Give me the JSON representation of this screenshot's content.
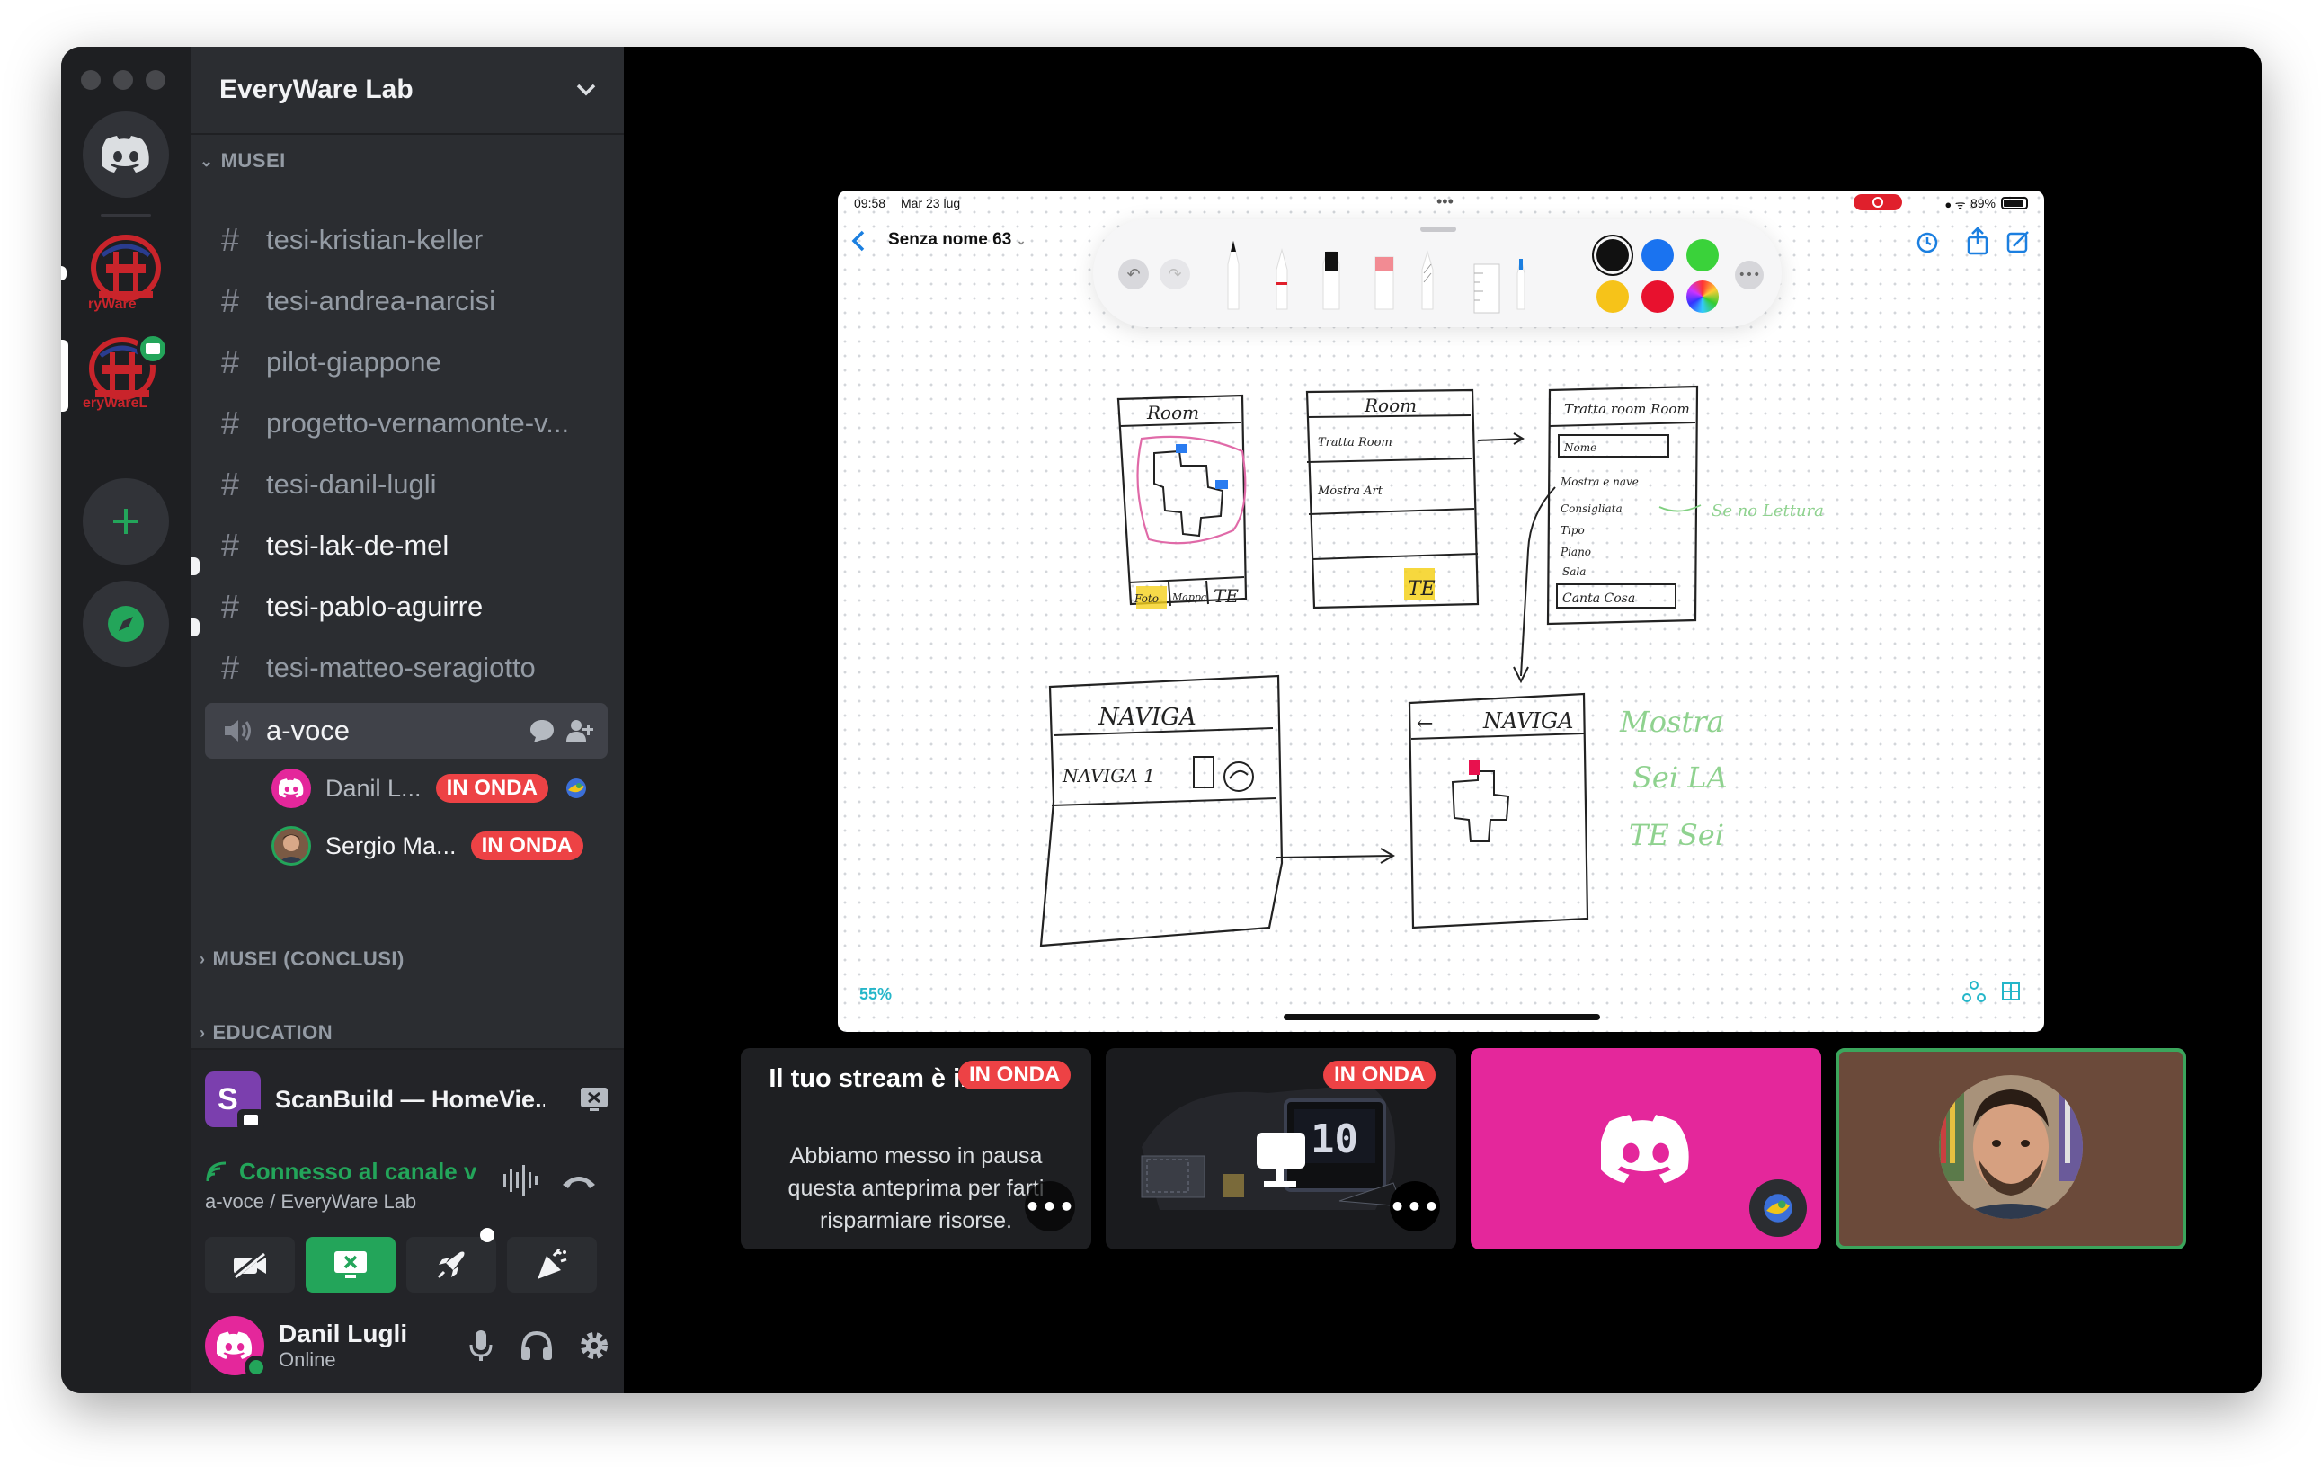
{
  "server": {
    "name": "EveryWare Lab",
    "rail_logo_text_1": "ryWare",
    "rail_logo_text_2": "eryWareL"
  },
  "categories": {
    "musei": "MUSEI",
    "musei_conclusi": "MUSEI (CONCLUSI)",
    "education": "EDUCATION"
  },
  "channels": [
    {
      "name": "tesi-kristian-keller",
      "unread": false
    },
    {
      "name": "tesi-andrea-narcisi",
      "unread": false
    },
    {
      "name": "pilot-giappone",
      "unread": false
    },
    {
      "name": "progetto-vernamonte-v...",
      "unread": false
    },
    {
      "name": "tesi-danil-lugli",
      "unread": false
    },
    {
      "name": "tesi-lak-de-mel",
      "unread": true
    },
    {
      "name": "tesi-pablo-aguirre",
      "unread": true
    },
    {
      "name": "tesi-matteo-seragiotto",
      "unread": false
    }
  ],
  "voice_channel": {
    "name": "a-voce",
    "users": [
      {
        "name": "Danil L...",
        "badge": "IN ONDA"
      },
      {
        "name": "Sergio Ma...",
        "badge": "IN ONDA"
      }
    ]
  },
  "voice_panel": {
    "stream_title": "ScanBuild — HomeVie...",
    "connection": "Connesso al canale vocale",
    "location": "a-voce / EveryWare Lab"
  },
  "user": {
    "name": "Danil Lugli",
    "status": "Online"
  },
  "ipad": {
    "time": "09:58",
    "date": "Mar 23 lug",
    "battery": "89%",
    "doc_title": "Senza nome 63",
    "zoom": "55%",
    "sketch_labels": {
      "room1": "Room",
      "room2": "Room",
      "room2_line1": "Tratta Room",
      "room2_line2": "Mostra Art",
      "list_title": "Tratta room Room",
      "list_items": [
        "Nome",
        "Mostra e nave",
        "Consigliata",
        "Tipo",
        "Piano",
        "Sala"
      ],
      "list_button": "Canta Cosa",
      "note_top": "Se no Lettura",
      "nave_title": "NAVIGA",
      "nave_sub": "NAVIGA 1",
      "nave2": "NAVIGA",
      "bottom_note": [
        "Mostra",
        "Sei LA",
        "TE Sei"
      ],
      "te_button": "TE"
    }
  },
  "tiles": {
    "badge": "IN ONDA",
    "own_stream_title": "Il tuo stream è in corso!",
    "own_stream_body": "Abbiamo messo in pausa questa anteprima per farti risparmiare risorse.",
    "more": "•••",
    "countdown": "10"
  },
  "colors": {
    "rail_bg": "#1e1f22",
    "sidebar_bg": "#2b2d31",
    "live_red": "#ed4245",
    "online_green": "#23a55a",
    "discord_pink": "#e4279b",
    "webcam_frame": "#3ba55c"
  }
}
